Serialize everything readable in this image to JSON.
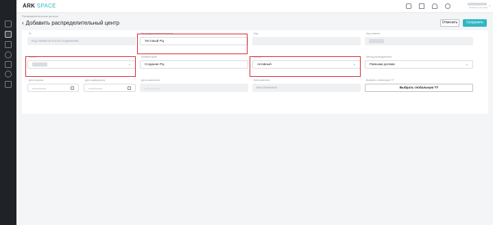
{
  "header": {
    "logo_main": "ARK",
    "logo_accent": "SPACE",
    "user_role": "Оператор сис-темы"
  },
  "breadcrumb": "Распределительные центры",
  "page": {
    "back_arrow": "‹",
    "title": "Добавить распределительный центр"
  },
  "actions": {
    "cancel_label": "Отменить",
    "save_label": "Сохранить"
  },
  "form": {
    "id": {
      "label": "ID",
      "value": "Код появится после сохранения"
    },
    "dc": {
      "label": "Распределительный центр*",
      "value": "Тестовый РЦ"
    },
    "code": {
      "label": "Код",
      "value": ""
    },
    "client_code": {
      "label": "Код клиента",
      "value": ""
    },
    "client": {
      "label": "Клиент*",
      "value": ""
    },
    "comment": {
      "label": "Комментарий",
      "value": "Создание РЦ"
    },
    "status": {
      "label": "Статус*",
      "value": "Активный"
    },
    "method": {
      "label": "Метод распределения",
      "value": "Равными долями"
    },
    "start_date": {
      "label": "Дата начала",
      "value": "__.__.____"
    },
    "end_date": {
      "label": "Дата завершения",
      "value": "__.__.____"
    },
    "change_date": {
      "label": "Дата изменения",
      "value": "__.__.____"
    },
    "changed_by": {
      "label": "Кем изменено",
      "value": "Кем изменено"
    },
    "global_tt": {
      "label": "Выбрать глобальную ТТ",
      "button": "Выбрать глобальную ТТ"
    }
  },
  "colors": {
    "accent": "#2fb6c4",
    "highlight": "#d9232d",
    "sidebar": "#1f2226"
  },
  "icons": {
    "chevron": "⌄"
  }
}
